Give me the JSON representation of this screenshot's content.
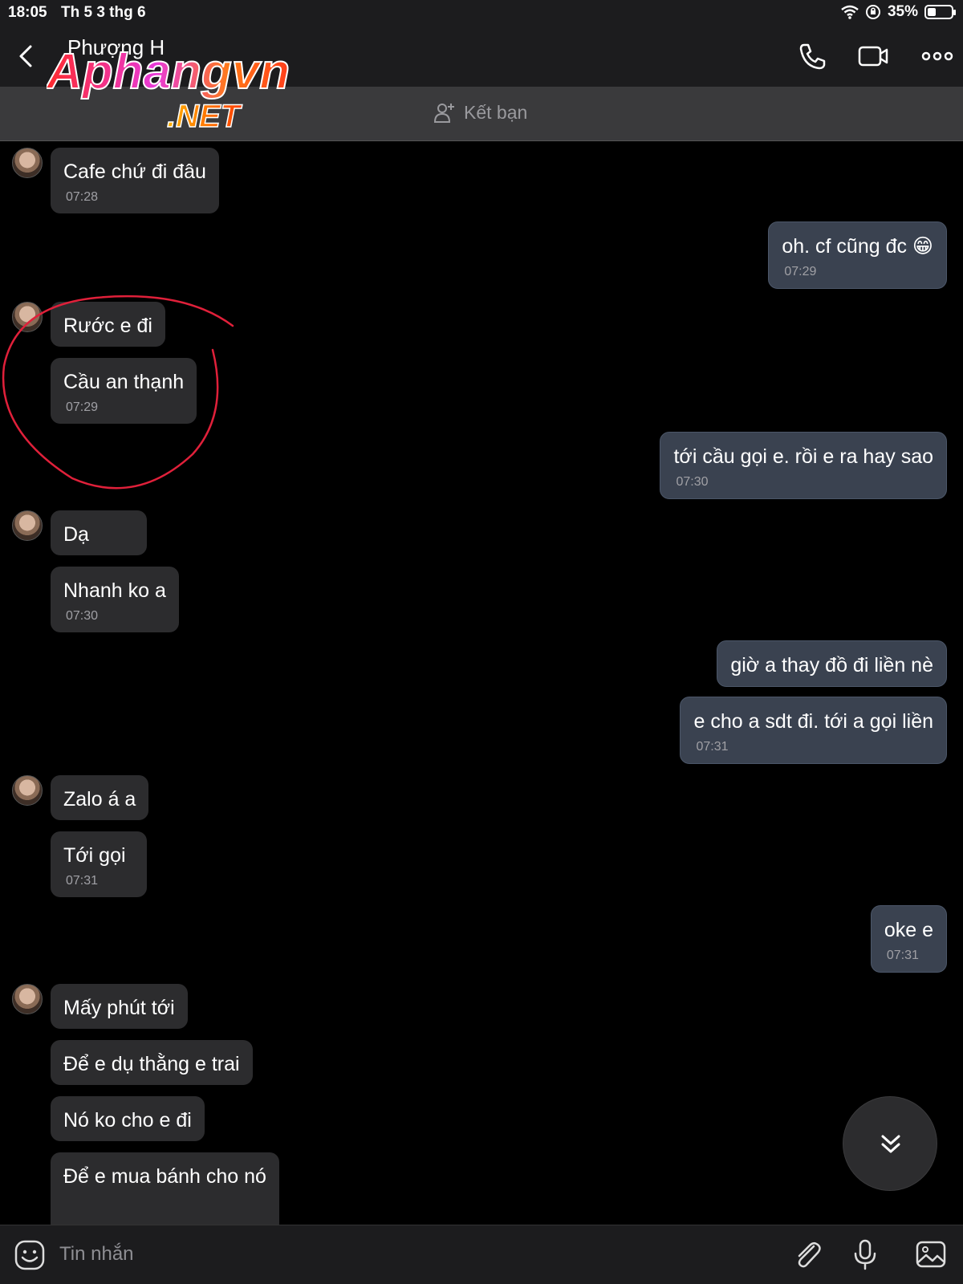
{
  "status": {
    "time": "18:05",
    "date": "Th 5 3 thg 6",
    "battery": "35%",
    "battery_level": 0.35
  },
  "header": {
    "contact_name": "Phượng H",
    "icons": [
      "back-icon",
      "phone-icon",
      "video-call-icon",
      "more-icon"
    ]
  },
  "logo": {
    "line1": "Aphangvn",
    "line2": ".NET"
  },
  "add_friend": {
    "label": "Kết bạn",
    "icon": "add-friend-icon"
  },
  "messages": [
    {
      "dir": "in",
      "text": "Cafe chứ đi đâu",
      "time": "07:28"
    },
    {
      "dir": "out",
      "text": "oh. cf cũng đc 😁",
      "time": "07:29"
    },
    {
      "dir": "in",
      "text": "Rước e đi",
      "time": ""
    },
    {
      "dir": "in",
      "text": "Cầu an thạnh",
      "time": "07:29"
    },
    {
      "dir": "out",
      "text": "tới cầu gọi e. rồi e ra hay sao",
      "time": "07:30"
    },
    {
      "dir": "in",
      "text": "Dạ",
      "time": ""
    },
    {
      "dir": "in",
      "text": "Nhanh ko a",
      "time": "07:30"
    },
    {
      "dir": "out",
      "text": "giờ a thay đồ đi liền nè",
      "time": ""
    },
    {
      "dir": "out",
      "text": "e cho a sdt đi. tới a gọi liền",
      "time": "07:31"
    },
    {
      "dir": "in",
      "text": "Zalo á a",
      "time": ""
    },
    {
      "dir": "in",
      "text": "Tới gọi",
      "time": "07:31"
    },
    {
      "dir": "out",
      "text": "oke e",
      "time": "07:31"
    },
    {
      "dir": "in",
      "text": "Mấy phút tới",
      "time": ""
    },
    {
      "dir": "in",
      "text": "Để e dụ thằng e trai",
      "time": ""
    },
    {
      "dir": "in",
      "text": "Nó ko cho e đi",
      "time": ""
    },
    {
      "dir": "in",
      "text": "Để e mua bánh cho nó",
      "time": ""
    }
  ],
  "input": {
    "placeholder": "Tin nhắn",
    "icons": [
      "emoji-icon",
      "attach-icon",
      "microphone-icon",
      "image-icon"
    ]
  },
  "colors": {
    "background": "#000000",
    "bar": "#1c1c1e",
    "incoming_bubble": "#2c2c2e",
    "outgoing_bubble": "#3a4250",
    "annotation": "#e0203a"
  }
}
